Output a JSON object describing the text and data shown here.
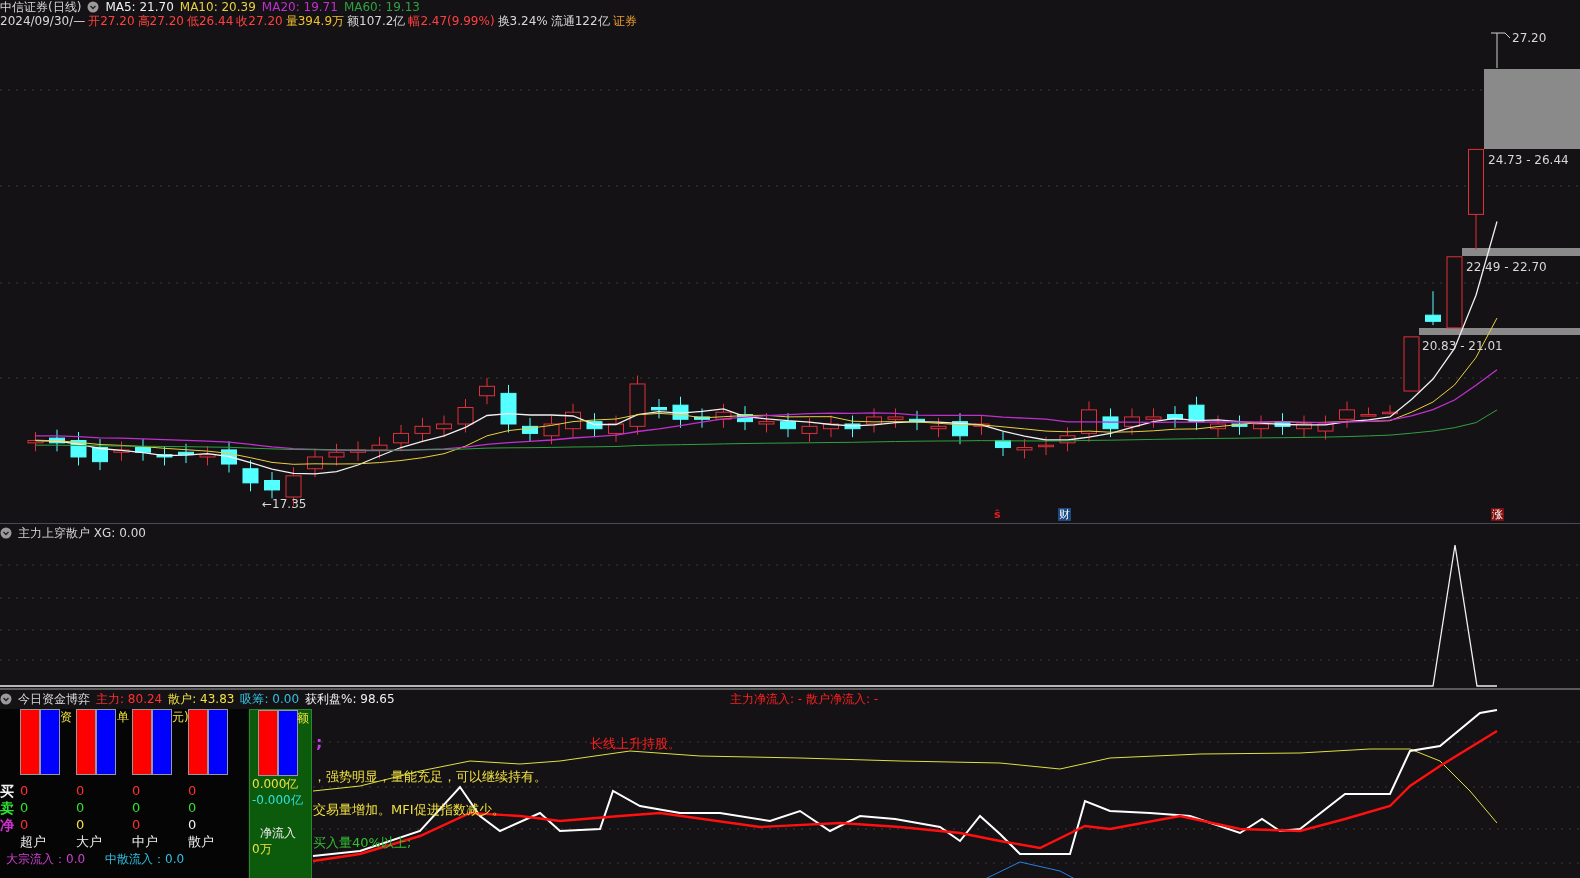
{
  "header": {
    "title": "中信证券(日线)",
    "ma": [
      {
        "label": "MA5: 21.70",
        "color": "#f0f0f0"
      },
      {
        "label": "MA10: 20.39",
        "color": "#e8d040"
      },
      {
        "label": "MA20: 19.71",
        "color": "#c030d0"
      },
      {
        "label": "MA60: 19.13",
        "color": "#30a040"
      }
    ]
  },
  "quote": [
    {
      "text": "2024/09/30/—",
      "color": "#d8d8d8"
    },
    {
      "text": "开27.20",
      "color": "#ff4040"
    },
    {
      "text": "高27.20",
      "color": "#ff4040"
    },
    {
      "text": "低26.44",
      "color": "#ff4040"
    },
    {
      "text": "收27.20",
      "color": "#ff4040"
    },
    {
      "text": "量394.9万",
      "color": "#f0c030"
    },
    {
      "text": "额107.2亿",
      "color": "#d8d8d8"
    },
    {
      "text": "幅2.47(9.99%)",
      "color": "#ff4040"
    },
    {
      "text": "换3.24%",
      "color": "#d8d8d8"
    },
    {
      "text": "流通122亿",
      "color": "#d8d8d8"
    },
    {
      "text": "证券",
      "color": "#f0a030"
    }
  ],
  "price_labels": {
    "high": "27.20",
    "low": "←17.35",
    "zones": [
      "24.73 - 26.44",
      "22.49 - 22.70",
      "20.83 - 21.01"
    ]
  },
  "markers": [
    {
      "text": "ŝ",
      "kind": "plain",
      "color": "#e02020"
    },
    {
      "text": "财",
      "kind": "boxed",
      "color": "#1c4a80"
    },
    {
      "text": "涨",
      "kind": "boxed",
      "color": "#801010"
    }
  ],
  "indicator": {
    "title": "主力上穿散户 XG: 0.00"
  },
  "fund_panel": {
    "title": "今日资金博弈",
    "stats": [
      {
        "label": "主力:",
        "value": "80.24",
        "color": "#ff3030"
      },
      {
        "label": "散户:",
        "value": "43.83",
        "color": "#f0e040"
      },
      {
        "label": "吸筹:",
        "value": "0.00",
        "color": "#30c0e0"
      },
      {
        "label": "获利盘%:",
        "value": "98.65",
        "color": "#f0f0f0"
      }
    ],
    "net_flow": "主力净流入: -  散户净流入: -",
    "signals": [
      {
        "text": ";",
        "color": "#c040e0"
      },
      {
        "text": "长线上升持股。",
        "color": "#ff2020"
      },
      {
        "text": "，强势明显，量能充足，可以继续持有。",
        "color": "#f0e040"
      },
      {
        "text": "交易量增加。MFI促进指数减少。",
        "color": "#f0e040"
      },
      {
        "text": "买入量40%以上;",
        "color": "#30c030"
      }
    ],
    "table": {
      "title_fragments": [
        "资",
        "单",
        "元)"
      ],
      "rows": [
        {
          "label": "买",
          "color": "#f0f0f0",
          "values": [
            {
              "text": "0",
              "color": "#ff3030"
            },
            {
              "text": "0",
              "color": "#ff3030"
            },
            {
              "text": "0",
              "color": "#ff3030"
            },
            {
              "text": "0",
              "color": "#ff3030"
            }
          ]
        },
        {
          "label": "卖",
          "color": "#30e030",
          "values": [
            {
              "text": "0",
              "color": "#30e030"
            },
            {
              "text": "0",
              "color": "#30e030"
            },
            {
              "text": "0",
              "color": "#30e030"
            },
            {
              "text": "0",
              "color": "#30e030"
            }
          ]
        },
        {
          "label": "净",
          "color": "#d030d0",
          "values": [
            {
              "text": "0",
              "color": "#ff3030"
            },
            {
              "text": "0",
              "color": "#f0e040"
            },
            {
              "text": "0",
              "color": "#ff3030"
            },
            {
              "text": "0",
              "color": "#f0f0f0"
            }
          ]
        }
      ],
      "columns": [
        "超户",
        "大户",
        "中户",
        "散户"
      ],
      "footer": [
        {
          "text": "大宗流入：0.0",
          "color": "#d040d0"
        },
        {
          "text": "中散流入：0.0",
          "color": "#30c0e0"
        }
      ]
    },
    "net_box": {
      "title_fragment": "额",
      "values": [
        {
          "text": "0.000亿",
          "color": "#f0e040"
        },
        {
          "text": "-0.000亿",
          "color": "#30e0e0"
        }
      ],
      "label": "净流入",
      "amount": "0万"
    }
  }
}
